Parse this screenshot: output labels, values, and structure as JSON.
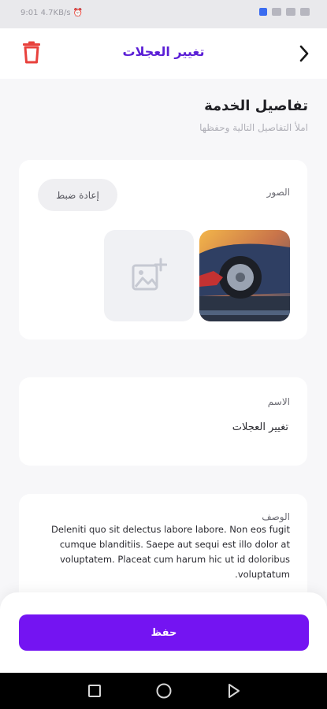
{
  "status_bar": {
    "left_text": "9:01 4.7KB/s ⏰"
  },
  "header": {
    "title": "تغيير العجلات"
  },
  "section": {
    "title": "تفاصيل الخدمة",
    "subtitle": "املأ التفاصيل التالية وحفظها"
  },
  "photos": {
    "label": "الصور",
    "reset_label": "إعادة ضبط",
    "icons": [
      "photo-thumbnail",
      "add-photo-icon"
    ]
  },
  "name_field": {
    "label": "الاسم",
    "value": "تغيير العجلات"
  },
  "description": {
    "label": "الوصف",
    "text": "Deleniti quo sit delectus labore labore. Non eos fugit cumque blanditiis. Saepe aut sequi est illo dolor at voluptatem. Placeat cum harum hic ut id doloribus voluptatum."
  },
  "footer": {
    "save_label": "حفظ"
  },
  "colors": {
    "accent": "#7414f2",
    "title": "#5b1fd6",
    "delete": "#e8413c"
  }
}
